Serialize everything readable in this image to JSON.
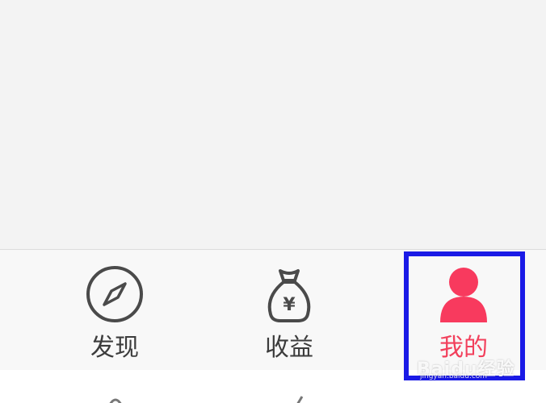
{
  "tabbar": {
    "tabs": [
      {
        "label": "发现",
        "icon": "compass-icon",
        "active": false
      },
      {
        "label": "收益",
        "icon": "money-bag-icon",
        "icon_symbol": "¥",
        "active": false
      },
      {
        "label": "我的",
        "icon": "user-icon",
        "active": true
      }
    ]
  },
  "watermark": {
    "text": "Baidu经验",
    "subtext": "jingyan.baidu.com"
  },
  "colors": {
    "active": "#f2405c",
    "inactive": "#3c3c3c",
    "highlight_border": "#1a1ae6",
    "content_bg": "#f3f3f3",
    "tabbar_bg": "#f8f8f8"
  }
}
